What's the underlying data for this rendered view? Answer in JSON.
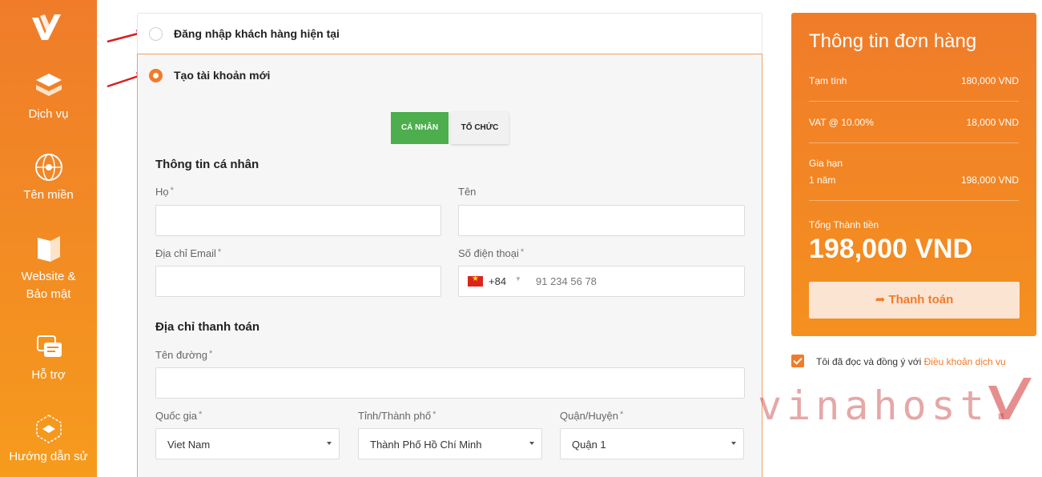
{
  "sidebar": {
    "logo_icon": "vinahost-v-logo",
    "items": [
      {
        "label": "Dịch vụ",
        "icon": "layers-icon"
      },
      {
        "label": "Tên miền",
        "icon": "globe-icon"
      },
      {
        "label": "Website & Bảo mật",
        "icon": "shield-book-icon"
      },
      {
        "label": "Hỗ trợ",
        "icon": "support-chat-icon"
      },
      {
        "label": "Hướng dẫn sử",
        "icon": "guide-icon"
      }
    ]
  },
  "account": {
    "existing_label": "Đăng nhập khách hàng hiện tại",
    "new_label": "Tạo tài khoản mới",
    "selected": "new"
  },
  "tabs": {
    "personal": "CÁ NHÂN",
    "organization": "TỔ CHỨC",
    "active": "personal"
  },
  "personal": {
    "title": "Thông tin cá nhân",
    "last_name_label": "Họ",
    "first_name_label": "Tên",
    "email_label": "Địa chỉ Email",
    "phone_label": "Số điện thoại",
    "phone_code": "+84",
    "phone_placeholder": "91 234 56 78"
  },
  "billing": {
    "title": "Địa chỉ thanh toán",
    "street_label": "Tên đường",
    "country_label": "Quốc gia",
    "country_value": "Viet Nam",
    "province_label": "Tỉnh/Thành phố",
    "province_value": "Thành Phố Hồ Chí Minh",
    "district_label": "Quận/Huyện",
    "district_value": "Quận 1"
  },
  "required_mark": "*",
  "order": {
    "title": "Thông tin đơn hàng",
    "subtotal_label": "Tạm tính",
    "subtotal_value": "180,000 VND",
    "vat_label": "VAT @ 10.00%",
    "vat_value": "18,000 VND",
    "renew_label": "Gia hạn",
    "renew_period": "1 năm",
    "renew_value": "198,000 VND",
    "total_label": "Tổng Thành tiền",
    "total_value": "198,000 VND",
    "pay_button": "Thanh toán"
  },
  "terms": {
    "text": "Tôi đã đọc và đồng ý với",
    "link": "Điều khoản dịch vụ",
    "checked": true
  },
  "watermark": "vinahost.",
  "colors": {
    "brand_orange": "#f07c2a",
    "active_green": "#4cae4c",
    "panel_bg": "#f6f6f6"
  }
}
